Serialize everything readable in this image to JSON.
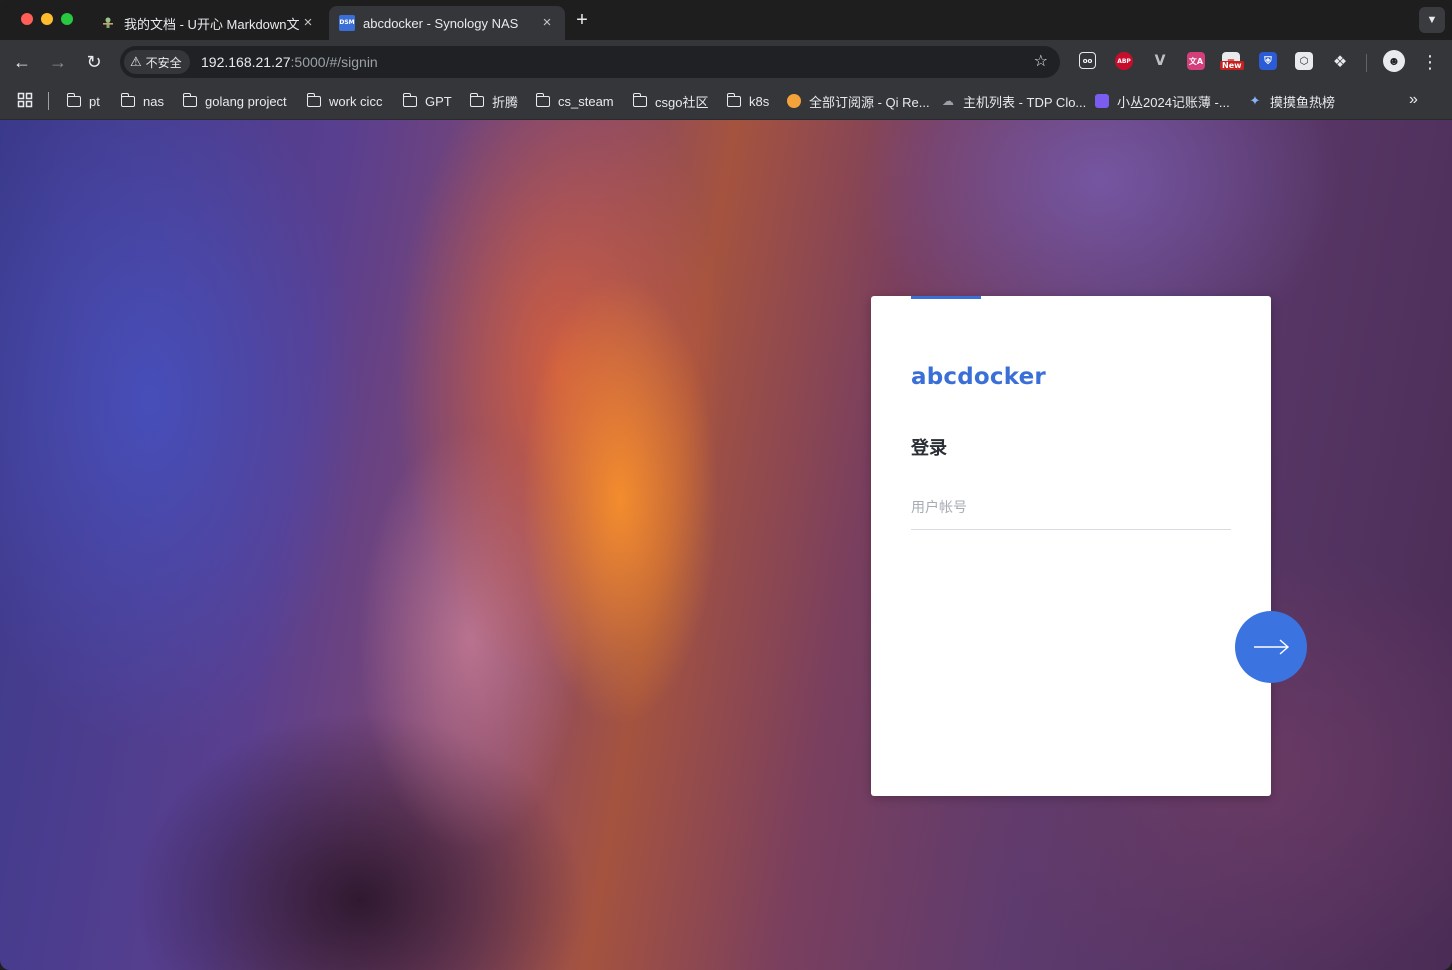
{
  "browser": {
    "tabs": [
      {
        "title": "我的文档 - U开心 Markdown文",
        "favicon": "u-kaixin-favicon"
      },
      {
        "title": "abcdocker - Synology NAS",
        "favicon": "dsm-favicon",
        "favicon_text": "DSM",
        "active": true
      }
    ],
    "address": {
      "security_label": "不安全",
      "host": "192.168.21.27",
      "rest": ":5000/#/signin"
    },
    "extensions": {
      "abp_label": "ABP",
      "new_badge": "New"
    },
    "bookmarks": [
      {
        "label": "pt",
        "type": "folder"
      },
      {
        "label": "nas",
        "type": "folder"
      },
      {
        "label": "golang project",
        "type": "folder"
      },
      {
        "label": "work cicc",
        "type": "folder"
      },
      {
        "label": "GPT",
        "type": "folder"
      },
      {
        "label": "折腾",
        "type": "folder"
      },
      {
        "label": "cs_steam",
        "type": "folder"
      },
      {
        "label": "csgo社区",
        "type": "folder"
      },
      {
        "label": "k8s",
        "type": "folder"
      },
      {
        "label": "全部订阅源 - Qi Re...",
        "type": "link"
      },
      {
        "label": "主机列表 - TDP Clo...",
        "type": "link"
      },
      {
        "label": "小丛2024记账薄 -...",
        "type": "link"
      },
      {
        "label": "摸摸鱼热榜",
        "type": "link"
      }
    ]
  },
  "login": {
    "brand": "abcdocker",
    "heading": "登录",
    "username_placeholder": "用户帐号",
    "accent_color": "#3b6fd8"
  }
}
